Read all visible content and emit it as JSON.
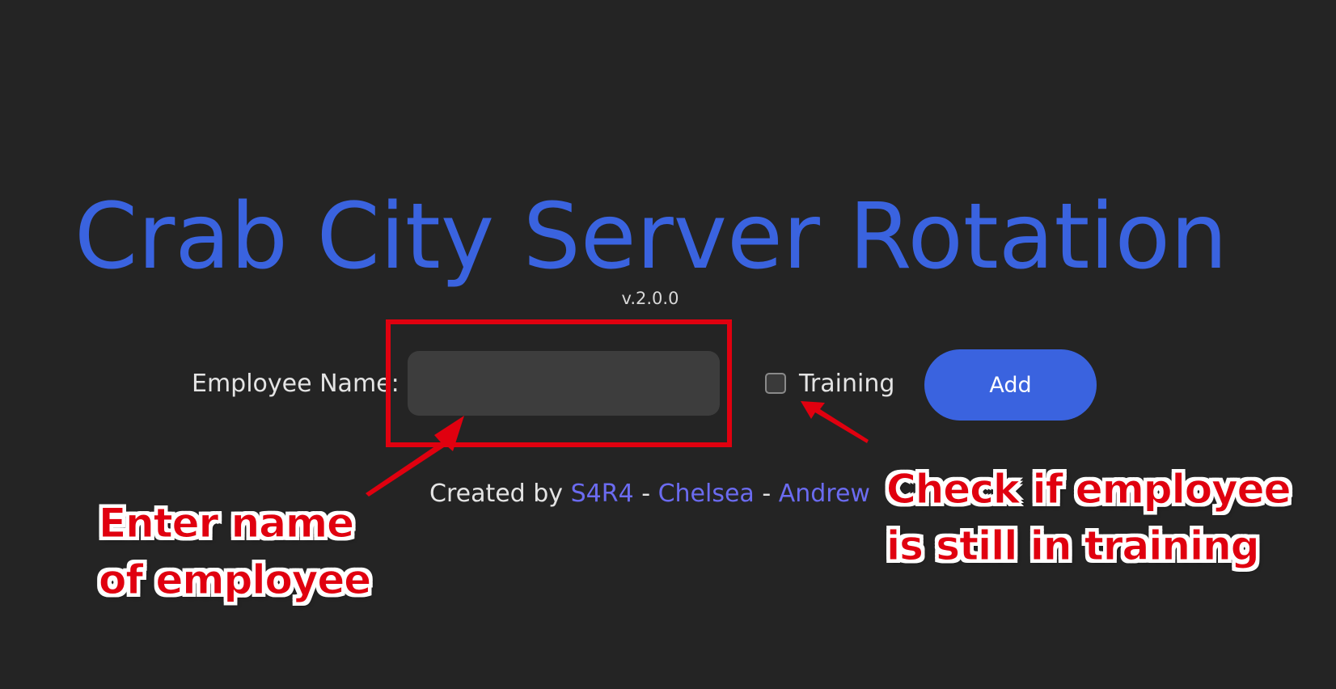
{
  "app": {
    "title": "Crab City Server Rotation",
    "version": "v.2.0.0"
  },
  "form": {
    "name_label": "Employee Name:",
    "name_value": "",
    "training_label": "Training",
    "training_checked": false,
    "add_label": "Add"
  },
  "credits": {
    "prefix": "Created by ",
    "separator": " - ",
    "authors": [
      "S4R4",
      "Chelsea",
      "Andrew"
    ]
  },
  "annotations": {
    "left_line1": "Enter name",
    "left_line2": "of employee",
    "right_line1": "Check if employee",
    "right_line2": "is still in training"
  },
  "colors": {
    "background": "#242424",
    "accent": "#3a63df",
    "link": "#6b6bf0",
    "annotation": "#e0000f"
  }
}
